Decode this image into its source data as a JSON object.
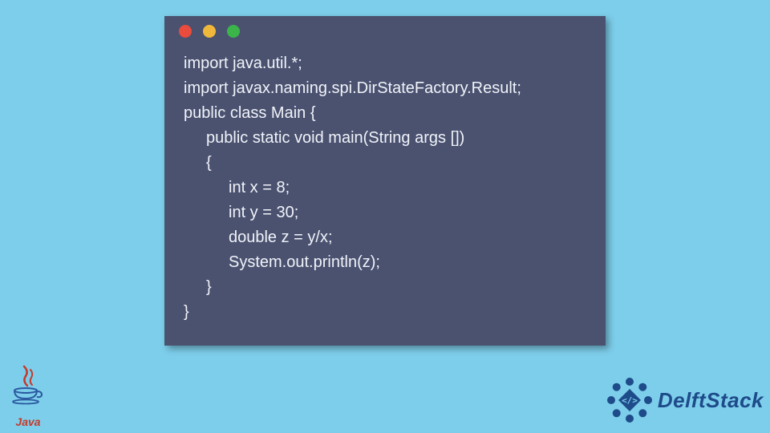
{
  "code": {
    "lines": [
      {
        "indent": 0,
        "text": "import java.util.*;"
      },
      {
        "indent": 0,
        "text": "import javax.naming.spi.DirStateFactory.Result;"
      },
      {
        "indent": 0,
        "text": "public class Main {"
      },
      {
        "indent": 1,
        "text": "public static void main(String args [])"
      },
      {
        "indent": 1,
        "text": "{"
      },
      {
        "indent": 2,
        "text": "int x = 8;"
      },
      {
        "indent": 2,
        "text": "int y = 30;"
      },
      {
        "indent": 2,
        "text": "double z = y/x;"
      },
      {
        "indent": 2,
        "text": "System.out.println(z);"
      },
      {
        "indent": 1,
        "text": "}"
      },
      {
        "indent": 0,
        "text": "}"
      }
    ]
  },
  "window_dots": {
    "red": "#e94b3c",
    "yellow": "#f0b83a",
    "green": "#3bb44a"
  },
  "java_logo": {
    "label": "Java"
  },
  "delft_logo": {
    "text": "DelftStack"
  },
  "colors": {
    "page_bg": "#7dceeb",
    "window_bg": "#4a5270",
    "code_text": "#f1f3f9",
    "java_color": "#c43a2b",
    "delft_color": "#1e4b8a"
  }
}
